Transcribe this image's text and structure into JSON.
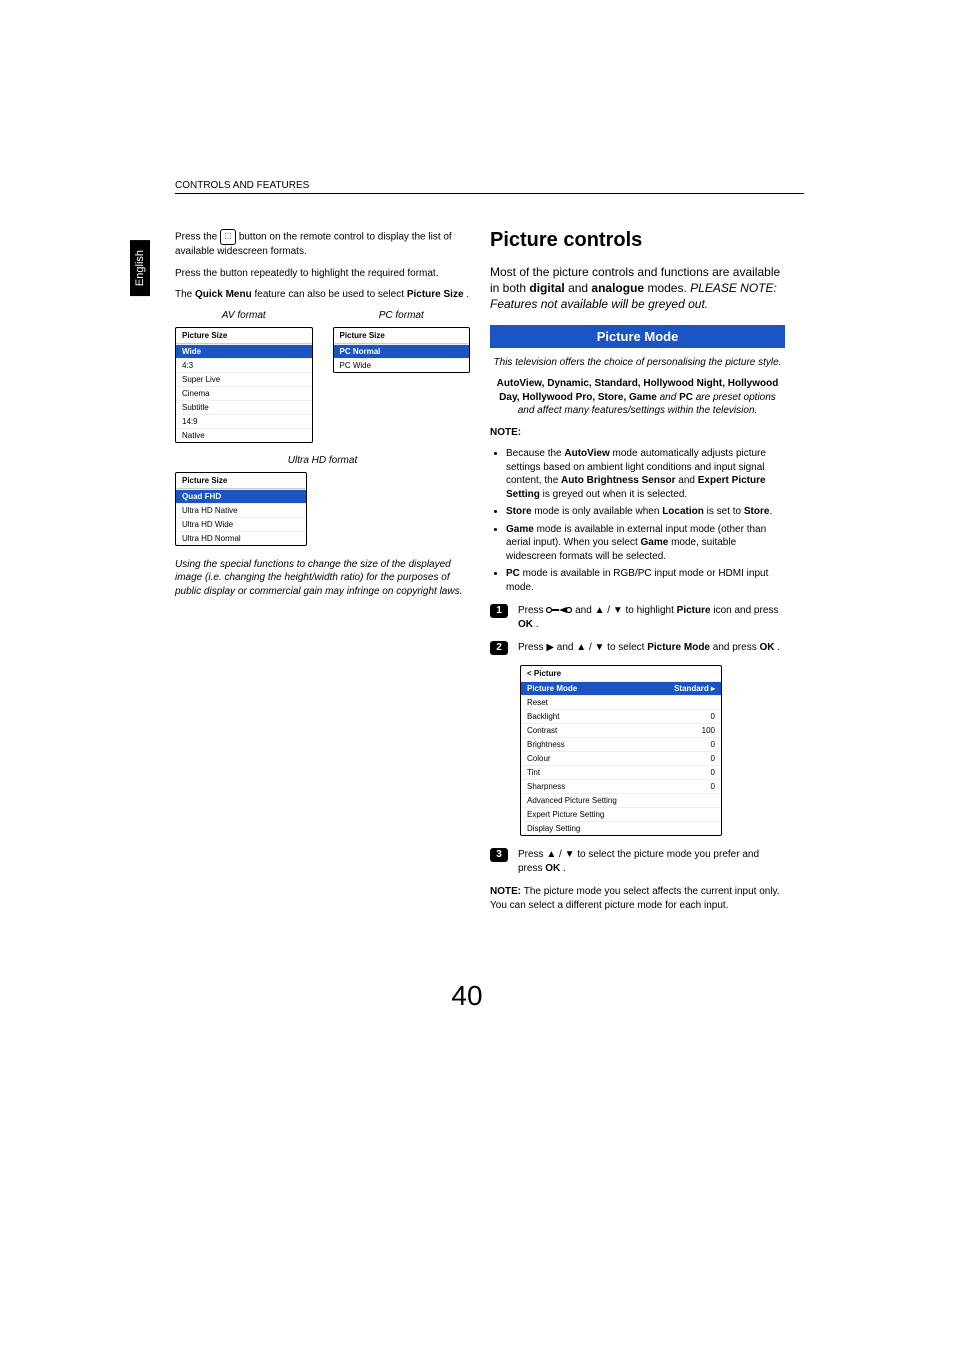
{
  "header": "CONTROLS AND FEATURES",
  "langTab": "English",
  "left": {
    "p1_a": "Press the ",
    "p1_b": " button on the remote control to display the list of available widescreen formats.",
    "p2": "Press the button repeatedly to highlight the required format.",
    "p3_a": "The ",
    "p3_quick": "Quick Menu",
    "p3_b": " feature can also be used to select ",
    "p3_size": "Picture Size",
    "p3_c": ".",
    "avCaption": "AV format",
    "pcCaption": "PC format",
    "uhdCaption": "Ultra HD format",
    "avMenu": {
      "title": "Picture Size",
      "items": [
        "Wide",
        "4:3",
        "Super Live",
        "Cinema",
        "Subtitle",
        "14:9",
        "Native"
      ]
    },
    "pcMenu": {
      "title": "Picture Size",
      "items": [
        "PC Normal",
        "PC Wide"
      ]
    },
    "uhdMenu": {
      "title": "Picture Size",
      "items": [
        "Quad FHD",
        "Ultra HD Native",
        "Ultra HD Wide",
        "Ultra HD Normal"
      ]
    },
    "footnote": "Using the special functions to change the size of the displayed image (i.e. changing the height/width ratio) for the purposes of public display or commercial gain may infringe on copyright laws."
  },
  "right": {
    "title": "Picture controls",
    "intro_a": "Most of the picture controls and functions are available in both ",
    "intro_digital": "digital",
    "intro_b": " and ",
    "intro_analogue": "analogue",
    "intro_c": " modes. ",
    "intro_note": "PLEASE NOTE: Features not available will be greyed out.",
    "modeBar": "Picture Mode",
    "modeIntro": "This television offers the choice of personalising the picture style.",
    "presets_a": "AutoView, Dynamic, Standard, Hollywood Night, Hollywood Day, Hollywood Pro, Store, Game",
    "presets_and": " and ",
    "presets_pc": "PC",
    "presets_b": " are preset options and affect many features/settings within the television.",
    "noteLabel": "NOTE:",
    "bullets": [
      {
        "a": "Because the ",
        "b1": "AutoView",
        "c": " mode automatically adjusts picture settings based on ambient light conditions and input signal content, the ",
        "b2": "Auto Brightness Sensor",
        "d": " and ",
        "b3": "Expert Picture Setting",
        "e": " is greyed out when it is selected."
      },
      {
        "a": "",
        "b1": "Store",
        "c": " mode is only available when ",
        "b2": "Location",
        "d": " is set to ",
        "b3": "Store",
        "e": "."
      },
      {
        "a": "",
        "b1": "Game",
        "c": " mode is available in external input mode (other than aerial input). When you select ",
        "b2": "Game",
        "d": " mode, suitable widescreen formats will be selected.",
        "b3": "",
        "e": ""
      },
      {
        "a": "",
        "b1": "PC",
        "c": " mode is available in RGB/PC input mode or HDMI input mode.",
        "b2": "",
        "d": "",
        "b3": "",
        "e": ""
      }
    ],
    "step1_a": "Press ",
    "step1_b": " and ▲ / ▼ to highlight ",
    "step1_pic": "Picture",
    "step1_c": " icon and press ",
    "step1_ok": "OK",
    "step1_d": ".",
    "step2_a": "Press ▶ and ▲ / ▼ to select ",
    "step2_pm": "Picture Mode",
    "step2_b": " and press ",
    "step2_ok": "OK",
    "step2_c": ".",
    "pictureMenu": {
      "header": "< Picture",
      "rows": [
        {
          "label": "Picture Mode",
          "value": "Standard ▸",
          "selected": true
        },
        {
          "label": "Reset",
          "value": ""
        },
        {
          "label": "Backlight",
          "value": "0"
        },
        {
          "label": "Contrast",
          "value": "100"
        },
        {
          "label": "Brightness",
          "value": "0"
        },
        {
          "label": "Colour",
          "value": "0"
        },
        {
          "label": "Tint",
          "value": "0"
        },
        {
          "label": "Sharpness",
          "value": "0"
        },
        {
          "label": "Advanced Picture Setting",
          "value": ""
        },
        {
          "label": "Expert Picture Setting",
          "value": ""
        },
        {
          "label": "Display Setting",
          "value": ""
        }
      ]
    },
    "step3_a": "Press ▲ / ▼ to select the picture mode you prefer and press ",
    "step3_ok": "OK",
    "step3_b": ".",
    "finalNote_a": "NOTE:",
    "finalNote_b": " The picture mode you select affects the current input only. You can select a different picture mode for each input."
  },
  "pageNumber": "40"
}
